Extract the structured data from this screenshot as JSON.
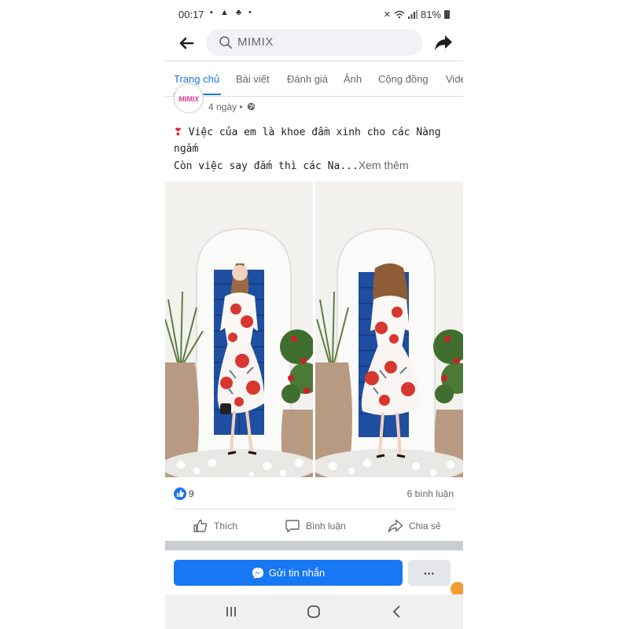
{
  "status_bar": {
    "time": "00:17",
    "battery": "81%"
  },
  "search": {
    "text": "MIMIX"
  },
  "tabs": [
    {
      "label": "Trang chủ",
      "active": true
    },
    {
      "label": "Bài viết",
      "active": false
    },
    {
      "label": "Đánh giá",
      "active": false
    },
    {
      "label": "Ảnh",
      "active": false
    },
    {
      "label": "Cộng đồng",
      "active": false
    },
    {
      "label": "Video",
      "active": false
    }
  ],
  "post": {
    "avatar_text": "MIMIX",
    "time": "4 ngày",
    "separator": "•",
    "line1": "Việc của em là khoe đầm xinh cho các Nàng ngắm",
    "line2": "Còn việc say đắm thì các Na...",
    "see_more": "Xem thêm",
    "like_count": "9",
    "comment_count": "6 bình luận"
  },
  "actions": {
    "like": "Thích",
    "comment": "Bình luận",
    "share": "Chia sẻ"
  },
  "bottom": {
    "message_button": "Gửi tin nhắn",
    "more_button": "···"
  },
  "colors": {
    "accent": "#1877f2",
    "text_secondary": "#65676b",
    "heart": "#e41e3f"
  }
}
